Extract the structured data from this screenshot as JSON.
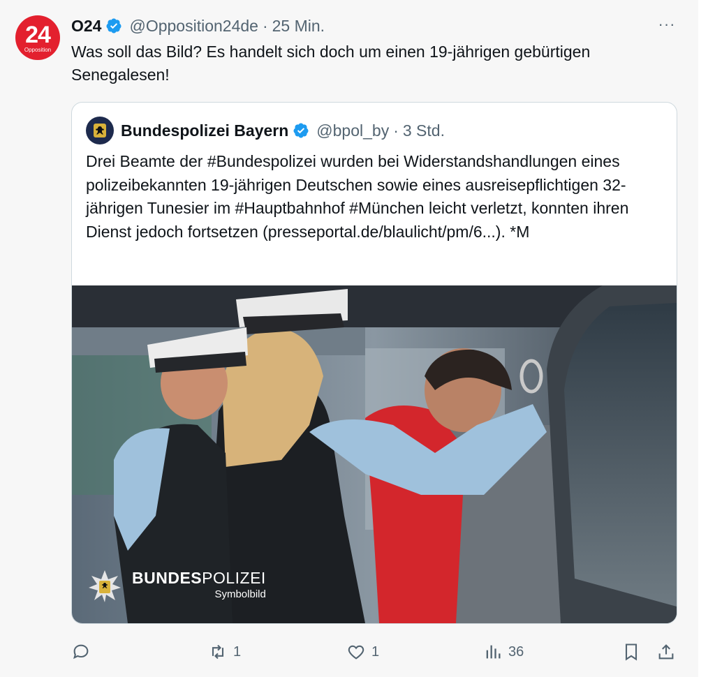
{
  "tweet": {
    "avatar_text": "24",
    "avatar_sub": "Opposition",
    "display_name": "O24",
    "handle": "@Opposition24de",
    "separator": "·",
    "time": "25 Min.",
    "more_label": "···",
    "text": "Was soll das Bild? Es handelt sich doch um einen 19-jährigen gebürtigen Senegalesen!"
  },
  "quoted": {
    "display_name": "Bundespolizei Bayern",
    "handle": "@bpol_by",
    "separator": "·",
    "time": "3 Std.",
    "text": "Drei Beamte der #Bundespolizei wurden bei Widerstandshandlungen eines polizeibekannten 19-jährigen Deutschen sowie eines ausreisepflichtigen 32-jährigen Tunesier im #Hauptbahnhof #München leicht verletzt, konnten ihren Dienst jedoch fortsetzen (presseportal.de/blaulicht/pm/6...). *M",
    "image": {
      "watermark_bold": "BUNDES",
      "watermark_regular": "POLIZEI",
      "caption": "Symbolbild"
    }
  },
  "actions": {
    "reply_count": "",
    "retweet_count": "1",
    "like_count": "1",
    "views_count": "36"
  },
  "icons": [
    "verified-badge-icon",
    "more-icon",
    "reply-icon",
    "retweet-icon",
    "like-icon",
    "views-icon",
    "bookmark-icon",
    "share-icon",
    "bundespolizei-eagle-icon"
  ],
  "colors": {
    "verified": "#1d9bf0",
    "muted": "#536471",
    "avatar_red": "#e3202e"
  }
}
